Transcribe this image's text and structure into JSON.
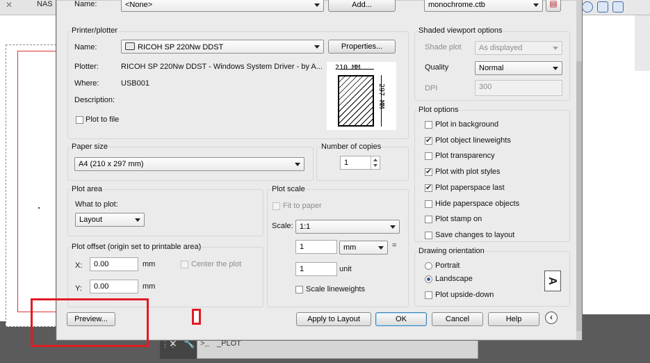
{
  "background": {
    "doc_tab_close": "✕",
    "doc_tab": "NAS",
    "command_line": {
      "close": "✕",
      "prompt": ">_",
      "text": "_PLOT"
    }
  },
  "page_setup": {
    "name_label": "Name:",
    "name_value": "<None>",
    "add_button": "Add..."
  },
  "plot_style_table": {
    "value": "monochrome.ctb"
  },
  "printer_plotter": {
    "title": "Printer/plotter",
    "name_label": "Name:",
    "name_value": "RICOH SP 220Nw DDST",
    "properties_button": "Properties...",
    "plotter_label": "Plotter:",
    "plotter_value": "RICOH SP 220Nw DDST - Windows System Driver - by A...",
    "where_label": "Where:",
    "where_value": "USB001",
    "description_label": "Description:",
    "plot_to_file_label": "Plot to file",
    "paper_width": "210 MM",
    "paper_height": "297 MM"
  },
  "paper_size": {
    "title": "Paper size",
    "value": "A4 (210 x 297 mm)"
  },
  "copies": {
    "title": "Number of copies",
    "value": "1"
  },
  "plot_area": {
    "title": "Plot area",
    "what_label": "What to plot:",
    "value": "Layout"
  },
  "plot_offset": {
    "title": "Plot offset (origin set to printable area)",
    "x_label": "X:",
    "x_value": "0.00",
    "x_unit": "mm",
    "y_label": "Y:",
    "y_value": "0.00",
    "y_unit": "mm",
    "center_label": "Center the plot"
  },
  "plot_scale": {
    "title": "Plot scale",
    "fit_label": "Fit to paper",
    "scale_label": "Scale:",
    "scale_value": "1:1",
    "value1": "1",
    "unit_value": "mm",
    "equals": "=",
    "value2": "1",
    "unit2": "unit",
    "scale_lw_label": "Scale lineweights"
  },
  "shaded_viewport": {
    "title": "Shaded viewport options",
    "shade_label": "Shade plot",
    "shade_value": "As displayed",
    "quality_label": "Quality",
    "quality_value": "Normal",
    "dpi_label": "DPI",
    "dpi_value": "300"
  },
  "plot_options": {
    "title": "Plot options",
    "items": [
      {
        "label": "Plot in background",
        "checked": false
      },
      {
        "label": "Plot object lineweights",
        "checked": true
      },
      {
        "label": "Plot transparency",
        "checked": false
      },
      {
        "label": "Plot with plot styles",
        "checked": true
      },
      {
        "label": "Plot paperspace last",
        "checked": true
      },
      {
        "label": "Hide paperspace objects",
        "checked": false
      },
      {
        "label": "Plot stamp on",
        "checked": false
      },
      {
        "label": "Save changes to layout",
        "checked": false
      }
    ]
  },
  "orientation": {
    "title": "Drawing orientation",
    "portrait": "Portrait",
    "landscape": "Landscape",
    "upside_down": "Plot upside-down",
    "selected": "Landscape",
    "icon_letter": "A"
  },
  "buttons": {
    "preview": "Preview...",
    "apply": "Apply to Layout",
    "ok": "OK",
    "cancel": "Cancel",
    "help": "Help",
    "more": "‹"
  },
  "icons": {
    "printer": "printer-icon",
    "plot_style_edit": "plot-style-edit-icon",
    "orientation": "landscape-orientation-icon"
  },
  "colors": {
    "highlight_frame": "#e01b24",
    "default_button_border": "#3c7fb1"
  }
}
